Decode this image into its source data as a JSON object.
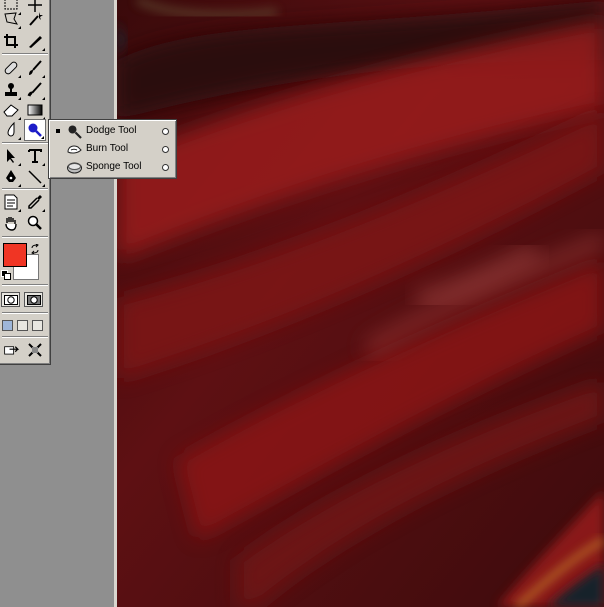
{
  "toolbox": {
    "tools": [
      {
        "name": "marquee-tool-icon"
      },
      {
        "name": "move-tool-icon"
      },
      {
        "name": "lasso-tool-icon"
      },
      {
        "name": "magic-wand-tool-icon"
      },
      {
        "name": "crop-tool-icon"
      },
      {
        "name": "slice-tool-icon"
      },
      {
        "name": "healing-brush-tool-icon"
      },
      {
        "name": "brush-tool-icon"
      },
      {
        "name": "clone-stamp-tool-icon"
      },
      {
        "name": "history-brush-tool-icon"
      },
      {
        "name": "eraser-tool-icon"
      },
      {
        "name": "gradient-tool-icon"
      },
      {
        "name": "blur-tool-icon"
      },
      {
        "name": "dodge-tool-icon"
      },
      {
        "name": "path-selection-tool-icon"
      },
      {
        "name": "type-tool-icon"
      },
      {
        "name": "pen-tool-icon"
      },
      {
        "name": "line-tool-icon"
      },
      {
        "name": "notes-tool-icon"
      },
      {
        "name": "eyedropper-tool-icon"
      },
      {
        "name": "hand-tool-icon"
      },
      {
        "name": "zoom-tool-icon"
      }
    ],
    "colors": {
      "foreground": "#f03524",
      "background": "#ffffff"
    }
  },
  "flyout": {
    "items": [
      {
        "label": "Dodge Tool",
        "selected": true,
        "icon": "dodge-tool-icon"
      },
      {
        "label": "Burn Tool",
        "selected": false,
        "icon": "burn-tool-icon"
      },
      {
        "label": "Sponge Tool",
        "selected": false,
        "icon": "sponge-tool-icon"
      }
    ]
  }
}
